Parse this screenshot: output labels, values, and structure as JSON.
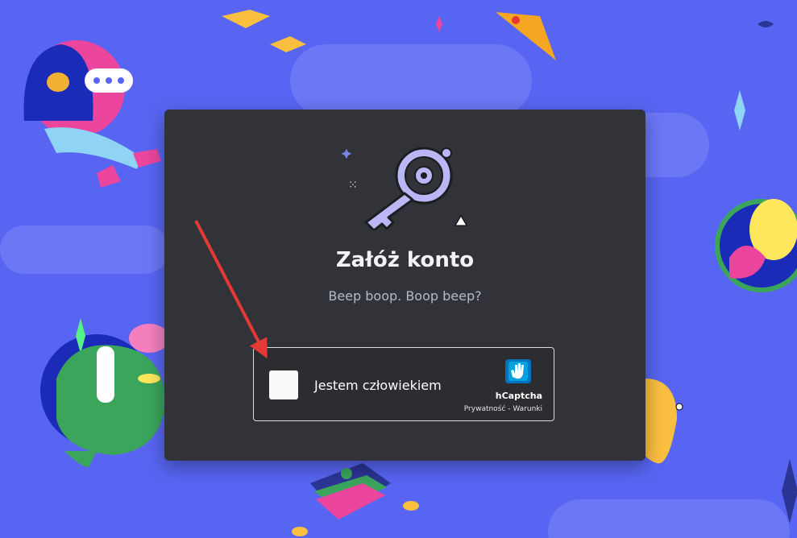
{
  "modal": {
    "title": "Załóż konto",
    "subtitle": "Beep boop. Boop beep?"
  },
  "captcha": {
    "label": "Jestem człowiekiem",
    "brand": "hCaptcha",
    "privacy_link": "Prywatność",
    "separator": " - ",
    "terms_link": "Warunki",
    "checked": false
  },
  "colors": {
    "background": "#5865f2",
    "modal": "#313338",
    "arrow": "#e53935",
    "key": "#b9b8f5"
  },
  "icons": {
    "key_illustration": "key-icon",
    "captcha_logo": "hcaptcha-hand-icon"
  }
}
